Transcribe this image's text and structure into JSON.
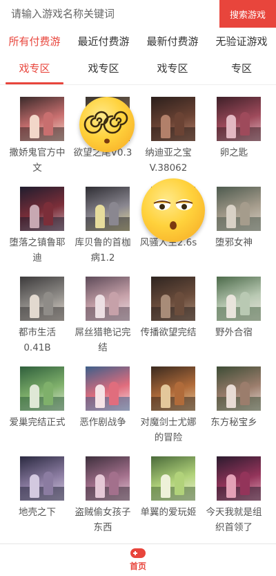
{
  "search": {
    "placeholder": "请输入游戏名称关键词",
    "button_label": "搜索游戏"
  },
  "tabs": [
    {
      "label": "所有付费游",
      "active": true
    },
    {
      "label": "最近付费游",
      "active": false
    },
    {
      "label": "最新付费游",
      "active": false
    },
    {
      "label": "无验证游戏",
      "active": false
    }
  ],
  "subtabs": [
    {
      "label": "戏专区",
      "active": true
    },
    {
      "label": "戏专区",
      "active": false
    },
    {
      "label": "戏专区",
      "active": false
    },
    {
      "label": "专区",
      "active": false
    }
  ],
  "games": [
    {
      "title": "撒娇鬼官方中文",
      "colors": [
        "#3a2a2a",
        "#c86f6f",
        "#f2d7c9"
      ]
    },
    {
      "title": "欲望之尾V0.3",
      "colors": [
        "#3b3530",
        "#7a6450",
        "#caa482"
      ]
    },
    {
      "title": "纳迪亚之宝V.38062",
      "colors": [
        "#2b1f1c",
        "#6b4334",
        "#b2806a"
      ]
    },
    {
      "title": "卵之匙",
      "colors": [
        "#3e2028",
        "#9e4a5b",
        "#e2b8c2"
      ]
    },
    {
      "title": "堕落之镇鲁耶迪",
      "colors": [
        "#1f1d2e",
        "#7b2e39",
        "#c7a8b2"
      ]
    },
    {
      "title": "库贝鲁的首枷病1.2",
      "colors": [
        "#2e2d33",
        "#8a8790",
        "#e6dc9c"
      ]
    },
    {
      "title": "风骚人生2.6s",
      "colors": [
        "#3a3a3a",
        "#777777",
        "#bdbdbd"
      ]
    },
    {
      "title": "堕邪女神",
      "colors": [
        "#4d5a4e",
        "#a59c8c",
        "#d8d1c6"
      ]
    },
    {
      "title": "都市生活0.41B",
      "colors": [
        "#3c3a3b",
        "#8f8c88",
        "#e2d9cf"
      ]
    },
    {
      "title": "屌丝猎艳记完结",
      "colors": [
        "#5d4a58",
        "#c6a1a9",
        "#ecdfe3"
      ]
    },
    {
      "title": "传播欲望完结",
      "colors": [
        "#2e2420",
        "#6b4d3c",
        "#a88c78"
      ]
    },
    {
      "title": "野外合宿",
      "colors": [
        "#4c6a4a",
        "#b9c9b3",
        "#e9e4dc"
      ]
    },
    {
      "title": "爱巢完结正式",
      "colors": [
        "#2f5f3c",
        "#7fb06b",
        "#dfe8d6"
      ]
    },
    {
      "title": "恶作剧战争",
      "colors": [
        "#3d5f8a",
        "#e06d7d",
        "#f5e3e6"
      ]
    },
    {
      "title": "对魔剑士尤娜的冒险",
      "colors": [
        "#3a2a1f",
        "#b06b3a",
        "#e3c79b"
      ]
    },
    {
      "title": "东方秘宝乡",
      "colors": [
        "#3d4c35",
        "#9b7d6c",
        "#e8dcd5"
      ]
    },
    {
      "title": "地壳之下",
      "colors": [
        "#2a2940",
        "#8b7ca1",
        "#d3c9e0"
      ]
    },
    {
      "title": "盗贼偷女孩子东西",
      "colors": [
        "#3d2f3c",
        "#a3708c",
        "#e5c8d6"
      ]
    },
    {
      "title": "单翼的爱玩姬",
      "colors": [
        "#4a6a3a",
        "#b1d27a",
        "#eef1d9"
      ]
    },
    {
      "title": "今天我就是组织首领了",
      "colors": [
        "#2b1b2e",
        "#93345a",
        "#e3a1b7"
      ]
    }
  ],
  "bottom_nav": {
    "home_label": "首页"
  },
  "colors": {
    "accent": "#e8453c",
    "text": "#333333",
    "muted": "#555555"
  }
}
